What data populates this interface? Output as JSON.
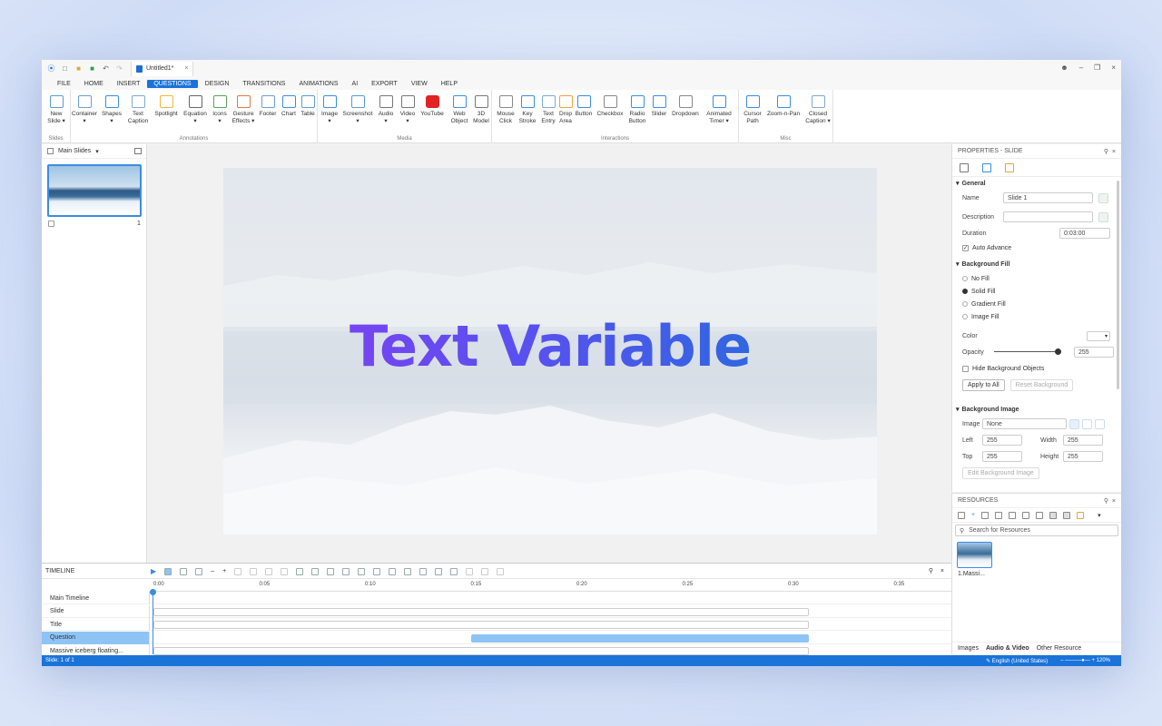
{
  "window": {
    "document_title": "Untitled1*"
  },
  "menu": [
    "FILE",
    "HOME",
    "INSERT",
    "QUESTIONS",
    "DESIGN",
    "TRANSITIONS",
    "ANIMATIONS",
    "AI",
    "EXPORT",
    "VIEW",
    "HELP"
  ],
  "menu_active": "QUESTIONS",
  "ribbon": {
    "groups": {
      "slides": "Slides",
      "annotations": "Annotations",
      "media": "Media",
      "interactions": "Interactions",
      "misc": "Misc"
    },
    "buttons": {
      "new_slide": [
        "New",
        "Slide ▾"
      ],
      "container": [
        "Container",
        "▾"
      ],
      "shapes": [
        "Shapes",
        "▾"
      ],
      "text_caption": [
        "Text",
        "Caption"
      ],
      "spotlight": [
        "Spotlight",
        ""
      ],
      "equation": [
        "Equation",
        "▾"
      ],
      "icons": [
        "Icons",
        "▾"
      ],
      "gesture_effects": [
        "Gesture",
        "Effects ▾"
      ],
      "footer": [
        "Footer",
        ""
      ],
      "chart": [
        "Chart",
        ""
      ],
      "table": [
        "Table",
        ""
      ],
      "image": [
        "Image",
        "▾"
      ],
      "screenshot": [
        "Screenshot",
        "▾"
      ],
      "audio": [
        "Audio",
        "▾"
      ],
      "video": [
        "Video",
        "▾"
      ],
      "youtube": [
        "YouTube",
        ""
      ],
      "web_object": [
        "Web",
        "Object"
      ],
      "model_3d": [
        "3D",
        "Model"
      ],
      "mouse_click": [
        "Mouse",
        "Click"
      ],
      "key_stroke": [
        "Key",
        "Stroke"
      ],
      "text_entry": [
        "Text",
        "Entry"
      ],
      "drop_area": [
        "Drop",
        "Area"
      ],
      "button": [
        "Button",
        ""
      ],
      "checkbox": [
        "Checkbox",
        ""
      ],
      "radio_button": [
        "Radio",
        "Button"
      ],
      "slider": [
        "Slider",
        ""
      ],
      "dropdown": [
        "Dropdown",
        ""
      ],
      "animated_timer": [
        "Animated",
        "Timer ▾"
      ],
      "cursor_path": [
        "Cursor",
        "Path"
      ],
      "zoom_n_pan": [
        "Zoom-n-Pan",
        ""
      ],
      "closed_caption": [
        "Closed",
        "Caption ▾"
      ]
    }
  },
  "slides_panel": {
    "header": "Main Slides",
    "slide_number": "1"
  },
  "slide": {
    "title_text": "Text Variable"
  },
  "properties": {
    "header": "PROPERTIES - SLIDE",
    "general": {
      "section": "General",
      "name_label": "Name",
      "name_value": "Slide 1",
      "description_label": "Description",
      "description_value": "",
      "duration_label": "Duration",
      "duration_value": "0:03:00",
      "auto_advance": "Auto Advance"
    },
    "background_fill": {
      "section": "Background Fill",
      "options": [
        "No Fill",
        "Solid Fill",
        "Gradient Fill",
        "Image Fill"
      ],
      "selected": "Solid Fill",
      "color_label": "Color",
      "opacity_label": "Opacity",
      "opacity_value": "255",
      "hide_bg": "Hide Background Objects",
      "apply_all": "Apply to All",
      "reset_bg": "Reset Background"
    },
    "background_image": {
      "section": "Background Image",
      "image_label": "Image",
      "image_value": "None",
      "left_label": "Left",
      "left_value": "255",
      "width_label": "Width",
      "width_value": "255",
      "top_label": "Top",
      "top_value": "255",
      "height_label": "Height",
      "height_value": "255",
      "edit_btn": "Edit Background Image"
    }
  },
  "resources": {
    "header": "RESOURCES",
    "search_placeholder": "Search for Resources",
    "item_label": "1.Massi...",
    "tabs": [
      "Images",
      "Audio & Video",
      "Other Resource"
    ],
    "active_tab": "Audio & Video"
  },
  "timeline": {
    "header": "TIMELINE",
    "ticks": [
      "0:00",
      "0:05",
      "0:10",
      "0:15",
      "0:20",
      "0:25",
      "0:30",
      "0:35"
    ],
    "rows": [
      {
        "name": "Main Timeline",
        "start": 0,
        "end": 0
      },
      {
        "name": "Slide",
        "start": 0,
        "end": 31
      },
      {
        "name": "Title",
        "start": 0,
        "end": 31
      },
      {
        "name": "Question",
        "start": 15,
        "end": 31
      },
      {
        "name": "Massive iceberg floating...",
        "start": 0,
        "end": 31
      }
    ],
    "selected_row": "Question"
  },
  "status": {
    "slide": "Slide: 1 of 1",
    "language": "English (United States)",
    "zoom": "120%"
  },
  "colors": {
    "accent": "#1a73d9",
    "title_gradient_start": "#8a3df0",
    "title_gradient_end": "#1a73d9"
  }
}
